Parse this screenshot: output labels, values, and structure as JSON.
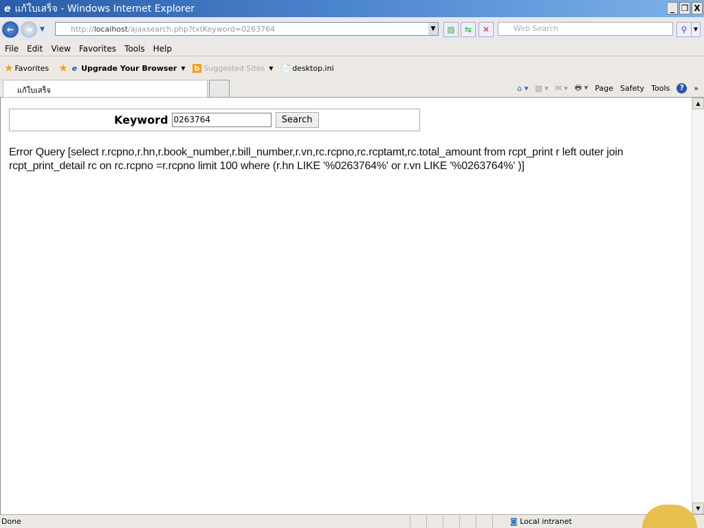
{
  "window": {
    "title": "แก้ใบเสร็จ - Windows Internet Explorer",
    "controls": [
      "_",
      "❐",
      "X"
    ]
  },
  "address": {
    "prefix": "http://",
    "host": "localhost",
    "path": "/ajaxsearch.php?txtKeyword=0263764"
  },
  "search_box": {
    "placeholder": "Web Search"
  },
  "menu": [
    "File",
    "Edit",
    "View",
    "Favorites",
    "Tools",
    "Help"
  ],
  "favorites_bar": {
    "favorites": "Favorites",
    "upgrade": "Upgrade Your Browser",
    "suggested": "Suggested Sites",
    "desktop": "desktop.ini"
  },
  "tab": {
    "title": "แก้ใบเสร็จ"
  },
  "command_bar": {
    "page": "Page",
    "safety": "Safety",
    "tools": "Tools",
    "more": "»"
  },
  "form": {
    "label": "Keyword",
    "value": "0263764",
    "button": "Search"
  },
  "error": "Error Query [select r.rcpno,r.hn,r.book_number,r.bill_number,r.vn,rc.rcpno,rc.rcptamt,rc.total_amount from rcpt_print r left outer join rcpt_print_detail rc on rc.rcpno =r.rcpno limit 100 where (r.hn LIKE '%0263764%' or r.vn LIKE '%0263764%' )]",
  "status": {
    "text": "Done",
    "zone": "Local intranet"
  }
}
